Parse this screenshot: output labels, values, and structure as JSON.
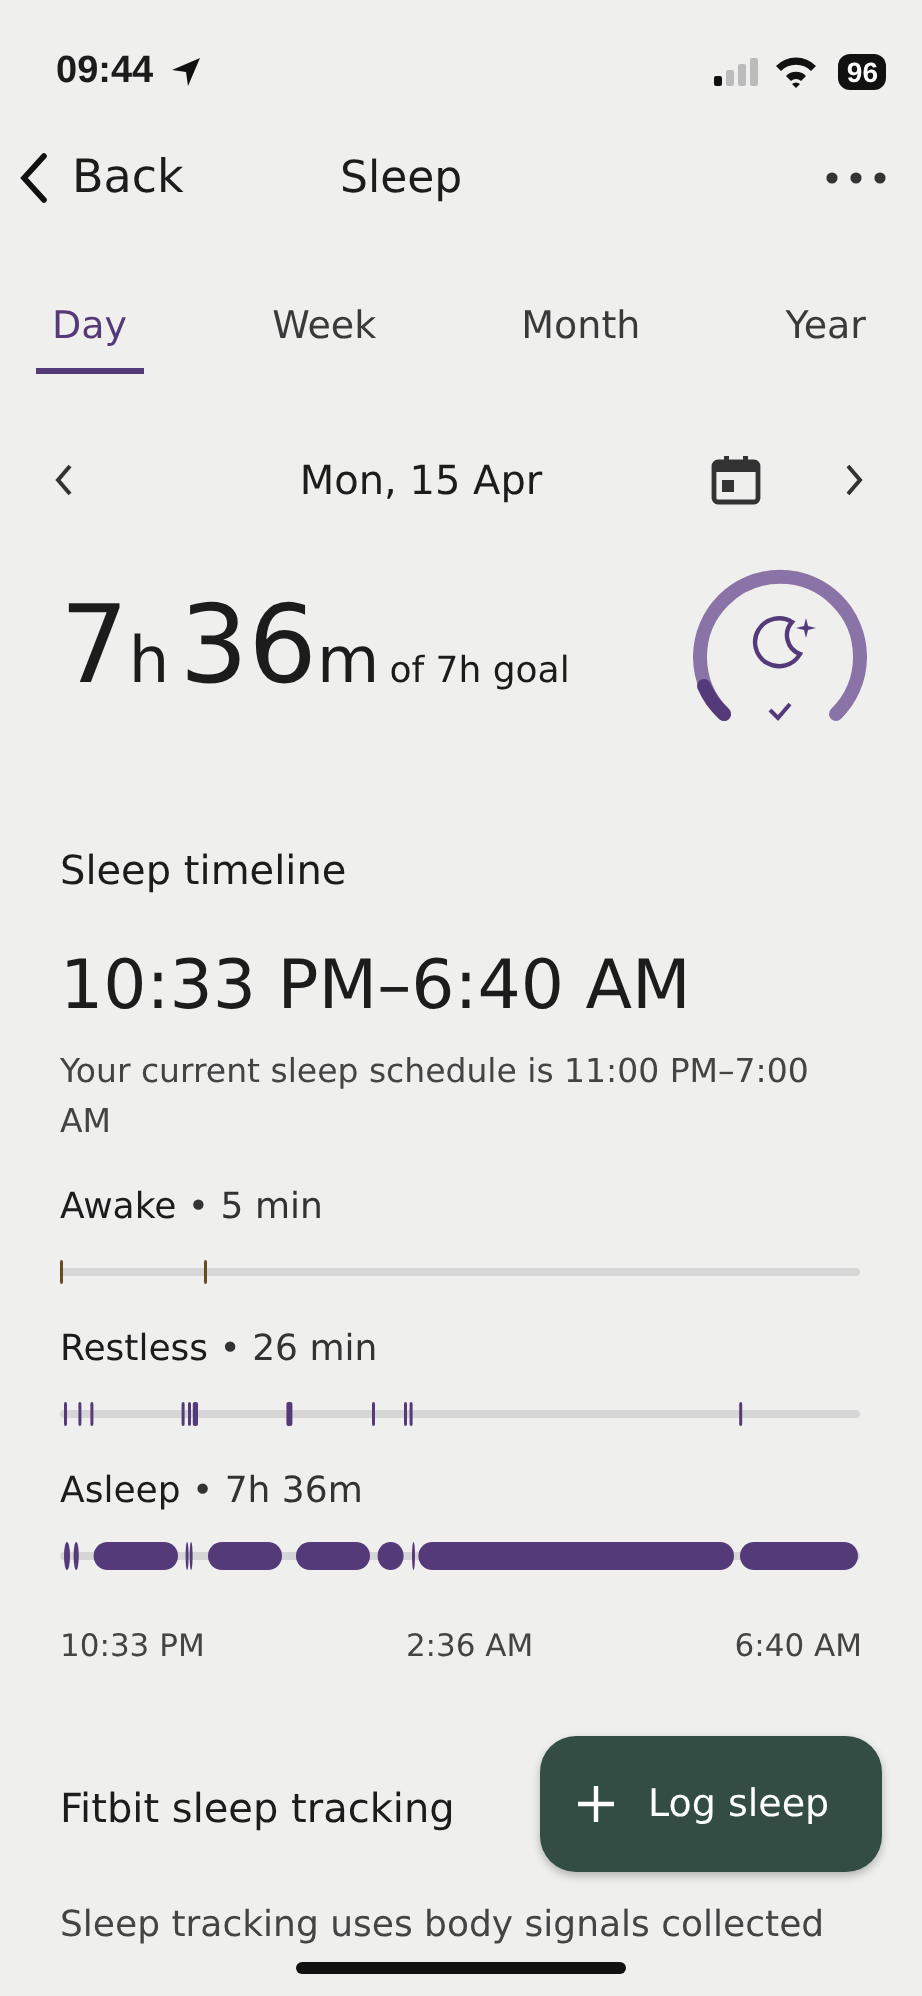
{
  "status_bar": {
    "time": "09:44",
    "battery": "96"
  },
  "nav": {
    "back": "Back",
    "title": "Sleep"
  },
  "tabs": [
    {
      "label": "Day",
      "selected": true
    },
    {
      "label": "Week",
      "selected": false
    },
    {
      "label": "Month",
      "selected": false
    },
    {
      "label": "Year",
      "selected": false
    }
  ],
  "date": "Mon, 15 Apr",
  "summary": {
    "hours": "7",
    "hours_unit": "h",
    "minutes": "36",
    "minutes_unit": "m",
    "goal": "of 7h goal"
  },
  "timeline": {
    "title": "Sleep timeline",
    "range": "10:33 PM–6:40 AM",
    "schedule": "Your current sleep schedule is 11:00 PM–7:00 AM",
    "stages": [
      {
        "name": "Awake",
        "duration": "• 5 min",
        "color": "#6b4a1e"
      },
      {
        "name": "Restless",
        "duration": "• 26 min",
        "color": "#553a7a"
      },
      {
        "name": "Asleep",
        "duration": "• 7h 36m",
        "color": "#553a7a"
      }
    ],
    "axis": [
      "10:33 PM",
      "2:36 AM",
      "6:40 AM"
    ]
  },
  "fab": {
    "label": "Log sleep"
  },
  "tracking": {
    "title": "Fitbit sleep tracking",
    "text": "Sleep tracking uses body signals collected"
  }
}
